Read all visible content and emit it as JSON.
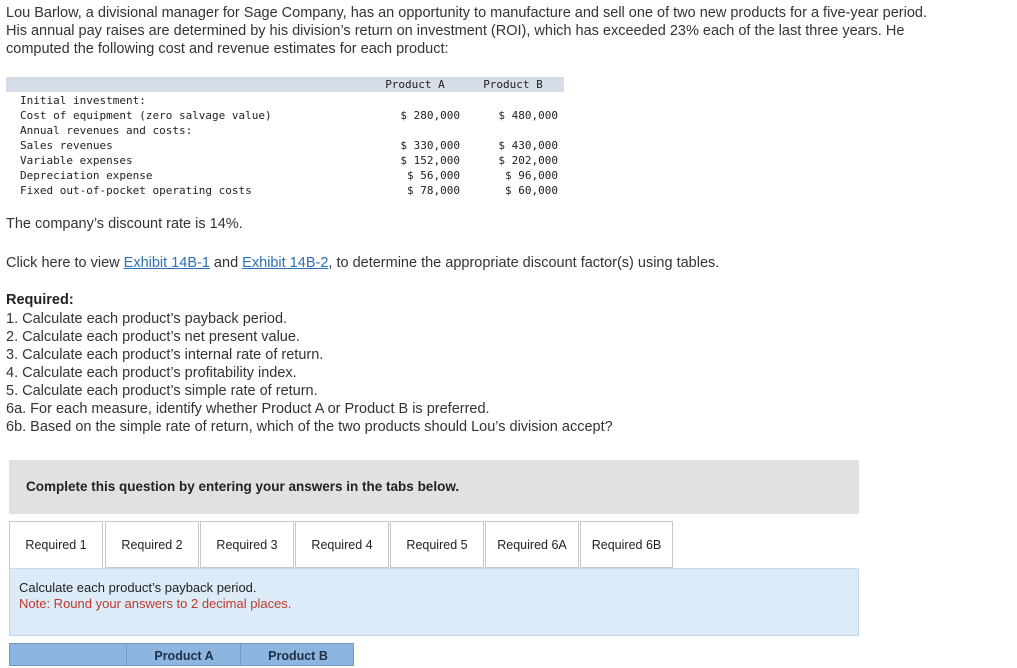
{
  "intro": "Lou Barlow, a divisional manager for Sage Company, has an opportunity to manufacture and sell one of two new products for a five-year period. His annual pay raises are determined by his division’s return on investment (ROI), which has exceeded 23% each of the last three years. He computed the following cost and revenue estimates for each product:",
  "table": {
    "col_a": "Product A",
    "col_b": "Product B",
    "rows": [
      {
        "label": "Initial investment:",
        "a": "",
        "b": ""
      },
      {
        "label": "Cost of equipment (zero salvage value)",
        "a": "$ 280,000",
        "b": "$ 480,000"
      },
      {
        "label": "Annual revenues and costs:",
        "a": "",
        "b": ""
      },
      {
        "label": "Sales revenues",
        "a": "$ 330,000",
        "b": "$ 430,000"
      },
      {
        "label": "Variable expenses",
        "a": "$ 152,000",
        "b": "$ 202,000"
      },
      {
        "label": "Depreciation expense",
        "a": "$ 56,000",
        "b": "$ 96,000"
      },
      {
        "label": "Fixed out-of-pocket operating costs",
        "a": "$ 78,000",
        "b": "$ 60,000"
      }
    ]
  },
  "discount_text": "The company’s discount rate is 14%.",
  "click": {
    "prefix": "Click here to view ",
    "link1": "Exhibit 14B-1",
    "and": " and ",
    "link2": "Exhibit 14B-2",
    "suffix": ", to determine the appropriate discount factor(s) using tables."
  },
  "required_title": "Required:",
  "required_items": [
    "1. Calculate each product’s payback period.",
    "2. Calculate each product’s net present value.",
    "3. Calculate each product’s internal rate of return.",
    "4. Calculate each product’s profitability index.",
    "5. Calculate each product’s simple rate of return.",
    "6a. For each measure, identify whether Product A or Product B is preferred.",
    "6b. Based on the simple rate of return, which of the two products should Lou’s division accept?"
  ],
  "banner": "Complete this question by entering your answers in the tabs below.",
  "tabs": [
    "Required 1",
    "Required 2",
    "Required 3",
    "Required 4",
    "Required 5",
    "Required 6A",
    "Required 6B"
  ],
  "active_tab": 0,
  "panel": {
    "instruction": "Calculate each product’s payback period.",
    "note": "Note: Round your answers to 2 decimal places."
  },
  "answer_table": {
    "col_a": "Product A",
    "col_b": "Product B"
  }
}
